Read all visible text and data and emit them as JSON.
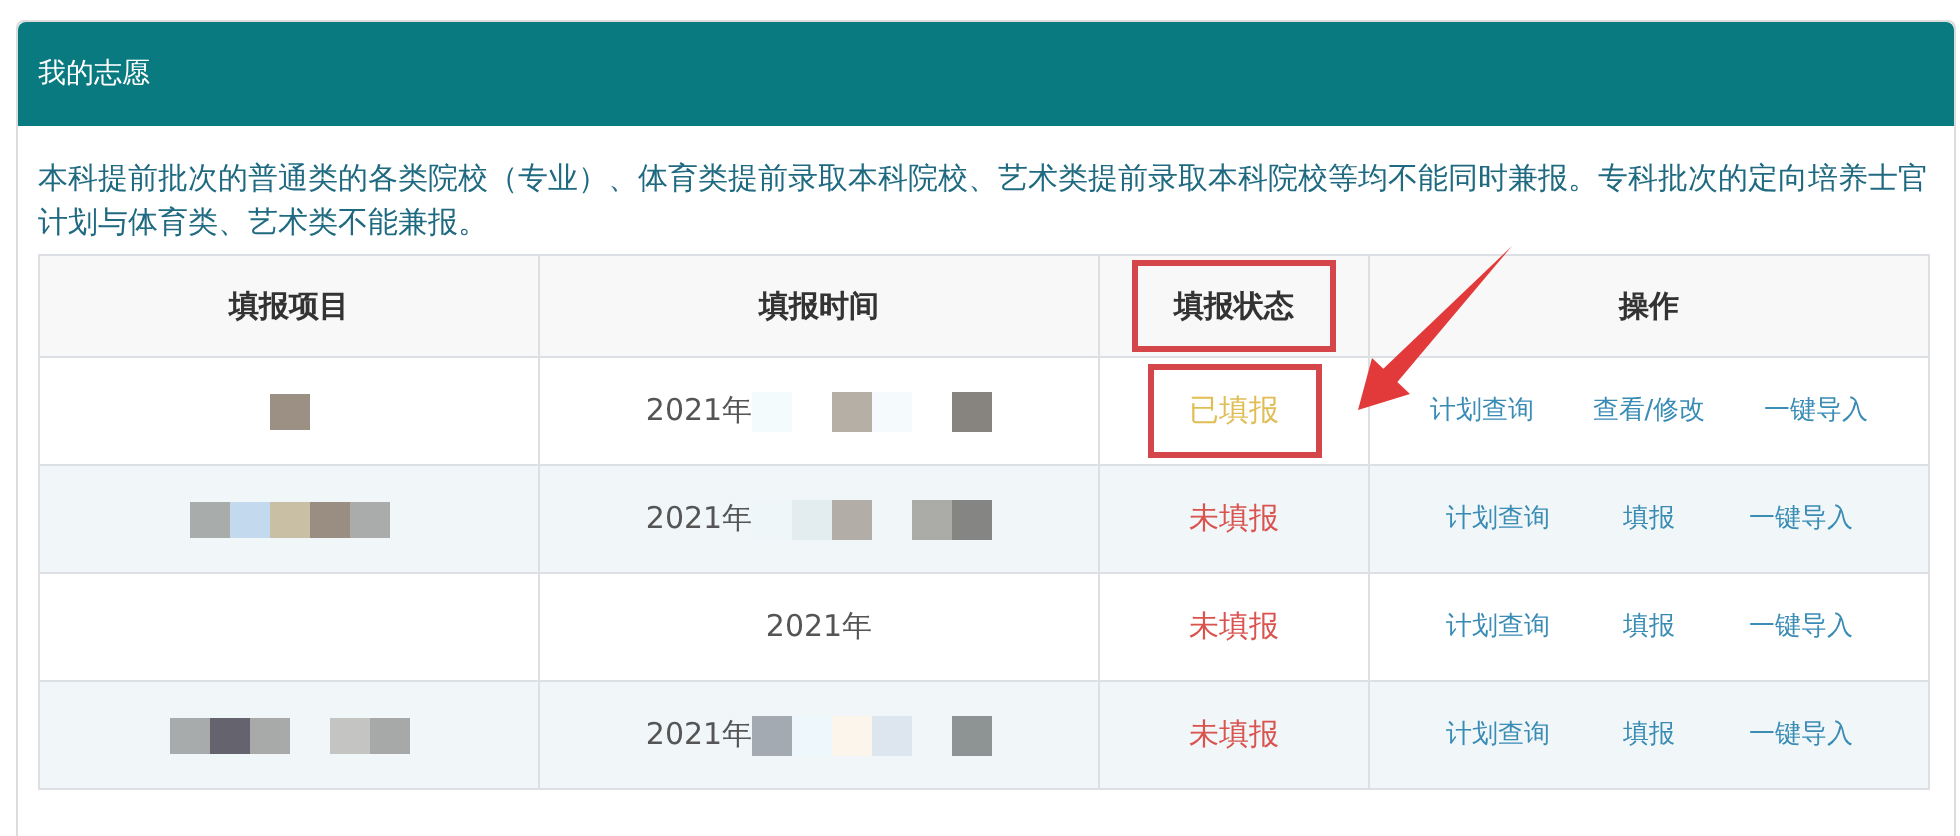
{
  "panel": {
    "title": "我的志愿"
  },
  "notice": "本科提前批次的普通类的各类院校（专业）、体育类提前录取本科院校、艺术类提前录取本科院校等均不能同时兼报。专科批次的定向培养士官计划与体育类、艺术类不能兼报。",
  "table": {
    "columns": [
      {
        "label": "填报项目",
        "highlighted": false
      },
      {
        "label": "填报时间",
        "highlighted": false
      },
      {
        "label": "填报状态",
        "highlighted": true
      },
      {
        "label": "操作",
        "highlighted": false
      }
    ],
    "rows": [
      {
        "time": "2021年",
        "status": {
          "text": "已填报",
          "kind": "filled"
        },
        "highlighted": true,
        "actions": [
          "计划查询",
          "查看/修改",
          "一键导入"
        ]
      },
      {
        "time": "2021年",
        "status": {
          "text": "未填报",
          "kind": "unfilled"
        },
        "highlighted": false,
        "actions": [
          "计划查询",
          "填报",
          "一键导入"
        ]
      },
      {
        "time": "2021年",
        "status": {
          "text": "未填报",
          "kind": "unfilled"
        },
        "highlighted": false,
        "actions": [
          "计划查询",
          "填报",
          "一键导入"
        ]
      },
      {
        "time": "2021年",
        "status": {
          "text": "未填报",
          "kind": "unfilled"
        },
        "highlighted": false,
        "actions": [
          "计划查询",
          "填报",
          "一键导入"
        ]
      }
    ]
  },
  "annotation_arrow": true
}
